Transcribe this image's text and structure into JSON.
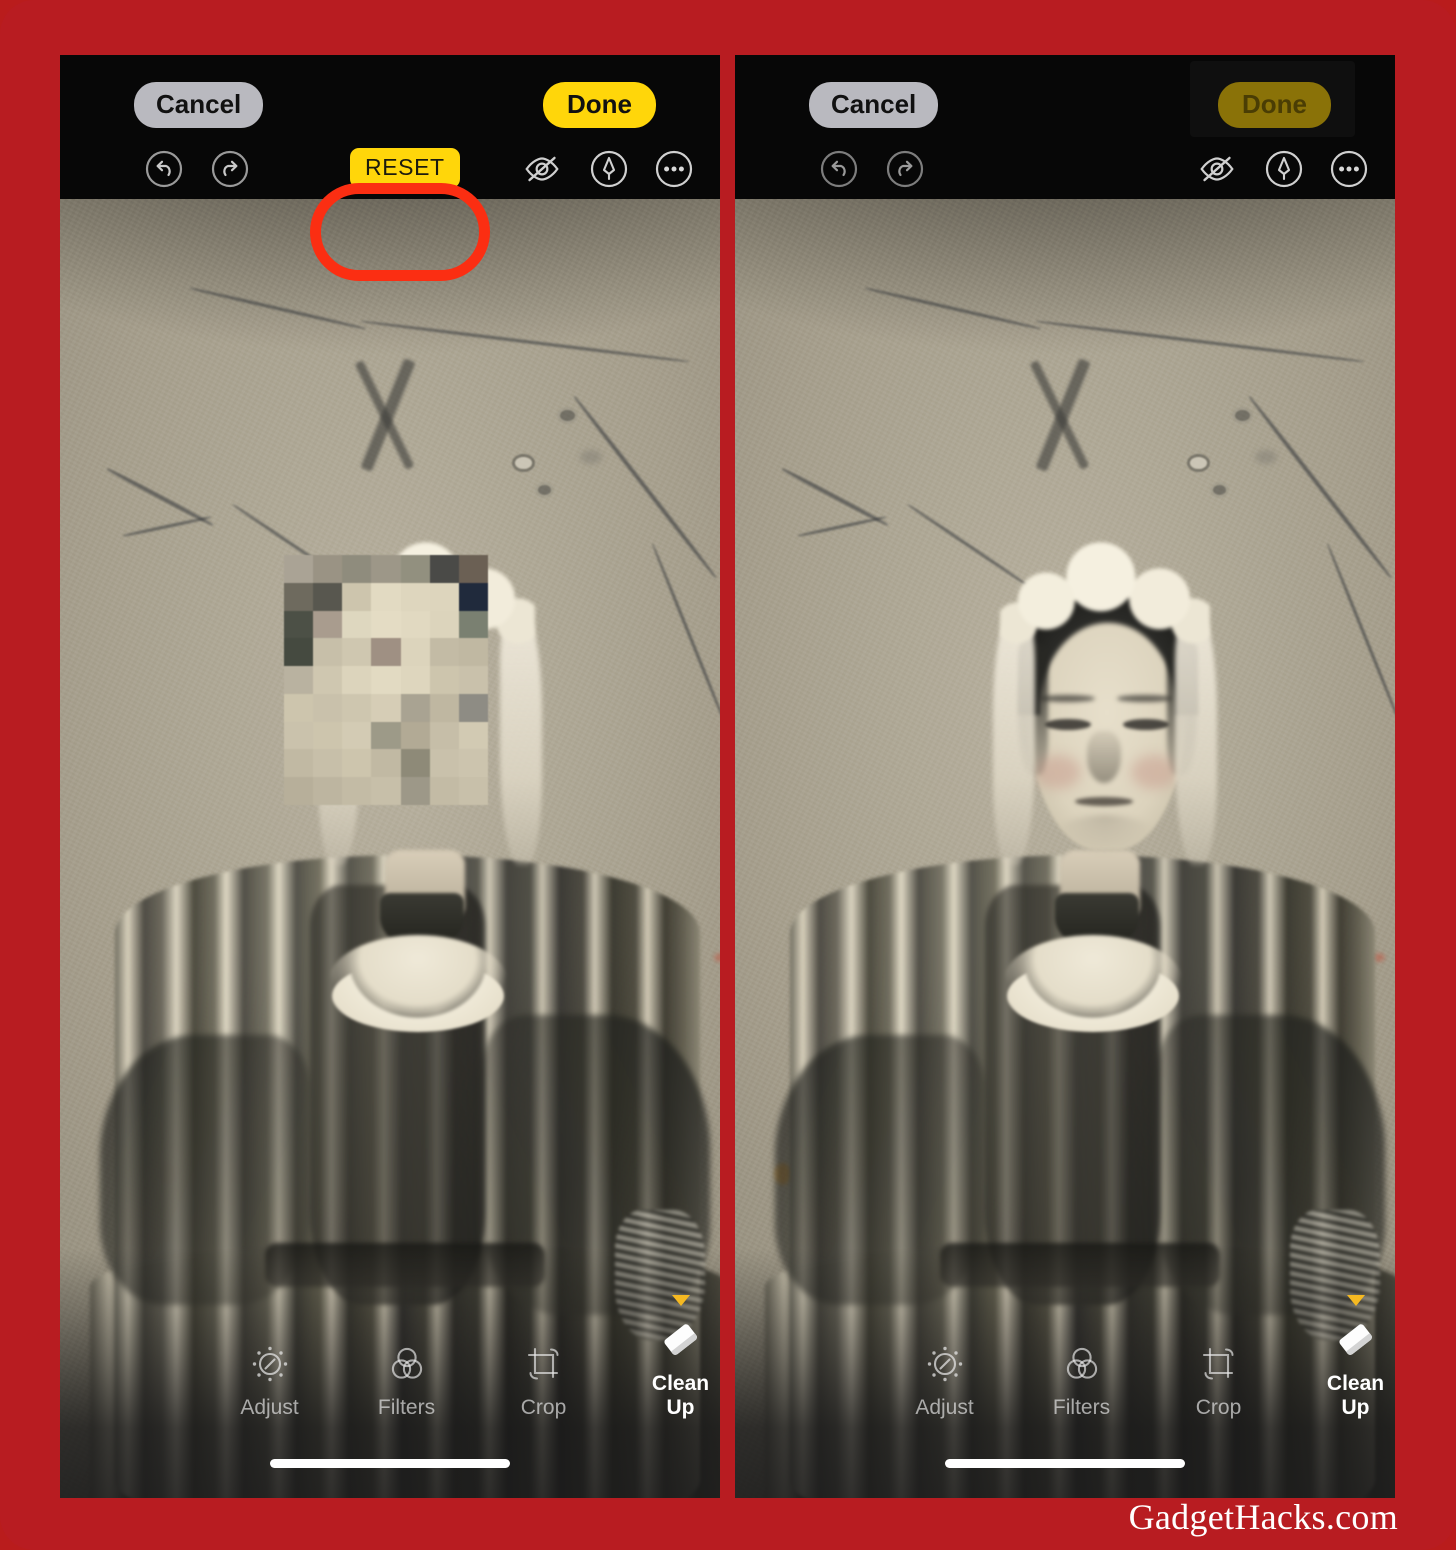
{
  "frame": {
    "border_color": "#b81c21",
    "watermark": "GadgetHacks.com"
  },
  "annotation": {
    "shape": "oval-highlight",
    "color": "#fb2e12",
    "targets": "reset-button"
  },
  "panels": [
    {
      "id": "before",
      "topbar": {
        "cancel_label": "Cancel",
        "done_label": "Done",
        "done_state": "enabled",
        "done_color": "#ffd60a"
      },
      "toolrow": {
        "undo_icon": "undo-arrow-icon",
        "redo_icon": "redo-arrow-icon",
        "reset_label": "RESET",
        "reset_visible": true,
        "reset_color": "#ffd60a",
        "hide_icon": "eye-slash-icon",
        "markup_icon": "markup-pen-icon",
        "more_icon": "more-ellipsis-icon"
      },
      "photo": {
        "description": "Vintage tintype portrait of a woman in a striped Victorian dress with a lace bonnet and collar",
        "face_state": "pixelated",
        "artifacts": [
          "x-scratch-mark",
          "surface-scratches",
          "emulsion-spots"
        ]
      },
      "bottombar": {
        "tools": [
          {
            "label": "Adjust",
            "icon": "adjust-dial-icon",
            "active": false
          },
          {
            "label": "Filters",
            "icon": "filters-circles-icon",
            "active": false
          },
          {
            "label": "Crop",
            "icon": "crop-rotate-icon",
            "active": false
          },
          {
            "label": "Clean Up",
            "icon": "eraser-icon",
            "active": true
          }
        ],
        "home_indicator": true
      }
    },
    {
      "id": "after",
      "topbar": {
        "cancel_label": "Cancel",
        "done_label": "Done",
        "done_state": "pressed",
        "done_color": "#8a7208"
      },
      "toolrow": {
        "undo_icon": "undo-arrow-icon",
        "redo_icon": "redo-arrow-icon",
        "reset_label": "RESET",
        "reset_visible": false,
        "reset_color": "#ffd60a",
        "hide_icon": "eye-slash-icon",
        "markup_icon": "markup-pen-icon",
        "more_icon": "more-ellipsis-icon"
      },
      "photo": {
        "description": "Vintage tintype portrait of a woman in a striped Victorian dress with a lace bonnet and collar",
        "face_state": "restored",
        "artifacts": [
          "x-scratch-mark",
          "surface-scratches",
          "emulsion-spots"
        ]
      },
      "bottombar": {
        "tools": [
          {
            "label": "Adjust",
            "icon": "adjust-dial-icon",
            "active": false
          },
          {
            "label": "Filters",
            "icon": "filters-circles-icon",
            "active": false
          },
          {
            "label": "Crop",
            "icon": "crop-rotate-icon",
            "active": false
          },
          {
            "label": "Clean Up",
            "icon": "eraser-icon",
            "active": true
          }
        ],
        "home_indicator": true
      }
    }
  ],
  "mosaic": {
    "cols": 7,
    "rows": 9,
    "colors": [
      "#aaa395",
      "#9a9384",
      "#8f8c7d",
      "#9d9788",
      "#92907f",
      "#4a4a47",
      "#6b6054",
      "#6e6a5e",
      "#58574f",
      "#cdc5ad",
      "#e2dac2",
      "#ded6be",
      "#ddd5bd",
      "#202a3c",
      "#4c5046",
      "#a99c8e",
      "#ded7bf",
      "#e4dcc4",
      "#e1d9c1",
      "#dcd4bc",
      "#7a8071",
      "#454a40",
      "#c7bfa9",
      "#cfc7b0",
      "#9f9083",
      "#dcd4bc",
      "#c3bba5",
      "#c0b8a2",
      "#b9b2a0",
      "#cfc7b0",
      "#dcd4bc",
      "#e2dac2",
      "#ded6be",
      "#cdc5ad",
      "#c9c1ab",
      "#cdc5ad",
      "#c9c1ab",
      "#cec6af",
      "#d6cdb6",
      "#a9a392",
      "#bfb7a1",
      "#8e8c84",
      "#cac2ac",
      "#cdc5ad",
      "#d3cbb4",
      "#9d9a88",
      "#b2aa95",
      "#c6bea8",
      "#d2cab3",
      "#c1b9a3",
      "#c7bfa9",
      "#cdc5ad",
      "#c1b9a3",
      "#8e8a78",
      "#c9c1ab",
      "#ccc4ae",
      "#b7af9a",
      "#bdb5a0",
      "#c3bba5",
      "#c7bfa9",
      "#9d9888",
      "#c3bba5",
      "#c8c0aa"
    ]
  }
}
